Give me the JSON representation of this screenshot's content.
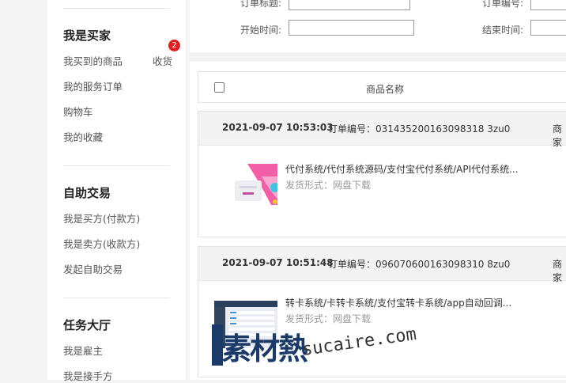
{
  "sidebar": {
    "buyer": {
      "title": "我是买家",
      "items": [
        "我买到的商品",
        "我的服务订单",
        "购物车",
        "我的收藏"
      ],
      "receive_label": "收货",
      "badge_count": "2"
    },
    "trade": {
      "title": "自助交易",
      "items": [
        "我是买方(付款方)",
        "我是卖方(收款方)",
        "发起自助交易"
      ]
    },
    "tasks": {
      "title": "任务大厅",
      "items": [
        "我是雇主",
        "我是接手方"
      ]
    }
  },
  "search": {
    "order_title_label": "订单标题:",
    "order_no_label": "订单编号:",
    "start_time_label": "开始时间:",
    "end_time_label": "结束时间:"
  },
  "table": {
    "col_product": "商品名称"
  },
  "orders": [
    {
      "date": "2021-09-07 10:53:03",
      "order_no": "订单编号：031435200163098318 3zu0",
      "shop": "商家",
      "title": "代付系统/代付系统源码/支付宝代付系统/API代付系统...",
      "shipping": "发货形式：网盘下载"
    },
    {
      "date": "2021-09-07 10:51:48",
      "order_no": "订单编号：096070600163098310 8zu0",
      "shop": "商家",
      "title": "转卡系统/卡转卡系统/支付宝转卡系统/app自动回调...",
      "shipping": "发货形式：网盘下载"
    }
  ],
  "watermark": {
    "cn": "素材熱",
    "en": "sucaire.com"
  }
}
